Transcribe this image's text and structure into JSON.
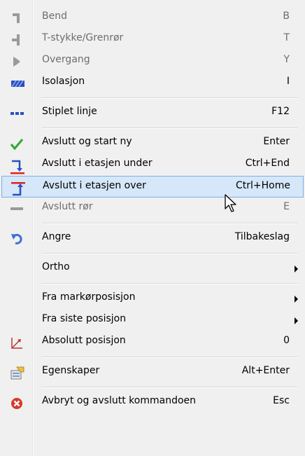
{
  "menu": {
    "items": [
      {
        "label": "Bend",
        "shortcut": "B",
        "icon": "bend-icon",
        "disabled": true
      },
      {
        "label": "T-stykke/Grenrør",
        "shortcut": "T",
        "icon": "tee-icon",
        "disabled": true
      },
      {
        "label": "Overgang",
        "shortcut": "Y",
        "icon": "reducer-icon",
        "disabled": true
      },
      {
        "label": "Isolasjon",
        "shortcut": "I",
        "icon": "insulation-icon",
        "disabled": false
      },
      {
        "label": "Stiplet linje",
        "shortcut": "F12",
        "icon": "dashed-line-icon",
        "disabled": false
      },
      {
        "label": "Avslutt og start ny",
        "shortcut": "Enter",
        "icon": "checkmark-icon",
        "disabled": false
      },
      {
        "label": "Avslutt i etasjen under",
        "shortcut": "Ctrl+End",
        "icon": "floor-below-icon",
        "disabled": false
      },
      {
        "label": "Avslutt i etasjen over",
        "shortcut": "Ctrl+Home",
        "icon": "floor-above-icon",
        "disabled": false,
        "highlighted": true
      },
      {
        "label": "Avslutt rør",
        "shortcut": "E",
        "icon": "end-pipe-icon",
        "disabled": true
      },
      {
        "label": "Angre",
        "shortcut": "Tilbakeslag",
        "icon": "undo-icon",
        "disabled": false
      },
      {
        "label": "Ortho",
        "submenu": true
      },
      {
        "label": "Fra markørposisjon",
        "submenu": true
      },
      {
        "label": "Fra siste posisjon",
        "submenu": true
      },
      {
        "label": "Absolutt posisjon",
        "shortcut": "0",
        "icon": "absolute-position-icon",
        "disabled": false
      },
      {
        "label": "Egenskaper",
        "shortcut": "Alt+Enter",
        "icon": "properties-icon",
        "disabled": false
      },
      {
        "label": "Avbryt og avslutt kommandoen",
        "shortcut": "Esc",
        "icon": "cancel-icon",
        "disabled": false
      }
    ]
  },
  "colors": {
    "highlight_bg": "#d5e7f8",
    "highlight_border": "#7ab0e5",
    "disabled_text": "#6d6d6d",
    "menu_bg": "#f0f0f0"
  }
}
